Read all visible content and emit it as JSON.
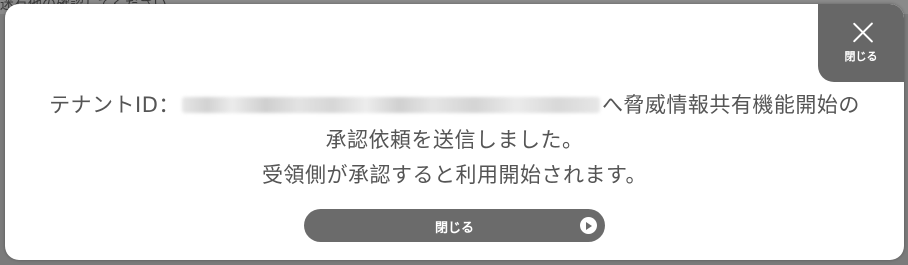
{
  "backdrop": {
    "partial_text": "迷有他の確認してください"
  },
  "modal": {
    "close_corner_label": "閉じる",
    "message": {
      "line1_prefix": "テナントID：",
      "line1_suffix": "へ脅威情報共有機能開始の",
      "line2": "承認依頼を送信しました。",
      "line3": "受領側が承認すると利用開始されます。"
    },
    "close_button_label": "閉じる"
  },
  "icons": {
    "corner": "close-x-icon",
    "button": "play-circle-icon"
  },
  "colors": {
    "overlay": "#7b7b7b",
    "dialog_bg": "#ffffff",
    "button_bg": "#6b6b6b",
    "text": "#555555"
  }
}
